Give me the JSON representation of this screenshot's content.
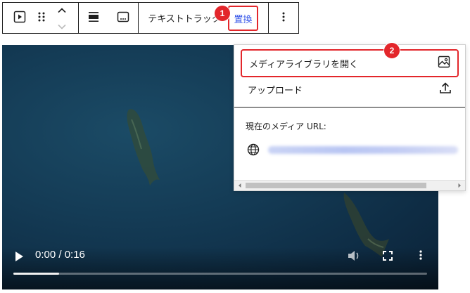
{
  "toolbar": {
    "text_track_label": "テキストトラック",
    "replace_label": "置換"
  },
  "badges": {
    "first": "1",
    "second": "2"
  },
  "video": {
    "time": "0:00 / 0:16",
    "progress": 0.11,
    "icons": [
      "play-icon",
      "volume-icon",
      "fullscreen-icon",
      "more-vertical-icon"
    ]
  },
  "dropdown": {
    "open_media_library": "メディアライブラリを開く",
    "upload": "アップロード",
    "current_url_label": "現在のメディア URL:"
  },
  "colors": {
    "highlight": "#e3262b",
    "accent": "#3858e9"
  }
}
